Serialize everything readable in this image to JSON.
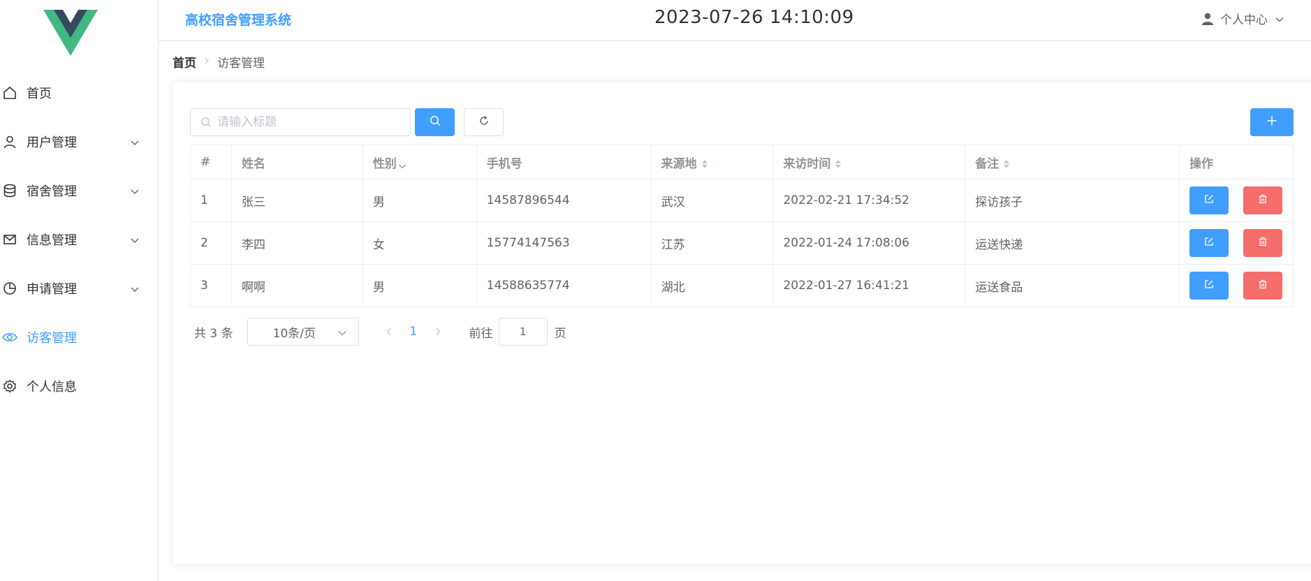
{
  "header": {
    "app_title": "高校宿舍管理系统",
    "datetime": "2023-07-26 14:10:09",
    "user_center_label": "个人中心"
  },
  "sidebar": {
    "items": [
      {
        "label": "首页",
        "icon": "home-icon",
        "has_submenu": false,
        "active": false
      },
      {
        "label": "用户管理",
        "icon": "user-icon",
        "has_submenu": true,
        "active": false
      },
      {
        "label": "宿舍管理",
        "icon": "database-icon",
        "has_submenu": true,
        "active": false
      },
      {
        "label": "信息管理",
        "icon": "mail-icon",
        "has_submenu": true,
        "active": false
      },
      {
        "label": "申请管理",
        "icon": "pie-chart-icon",
        "has_submenu": true,
        "active": false
      },
      {
        "label": "访客管理",
        "icon": "eye-icon",
        "has_submenu": false,
        "active": true
      },
      {
        "label": "个人信息",
        "icon": "gear-icon",
        "has_submenu": false,
        "active": false
      }
    ]
  },
  "breadcrumb": {
    "home": "首页",
    "current": "访客管理"
  },
  "toolbar": {
    "search_placeholder": "请输入标题"
  },
  "table": {
    "columns": [
      "#",
      "姓名",
      "性别",
      "手机号",
      "来源地",
      "来访时间",
      "备注",
      "操作"
    ],
    "rows": [
      {
        "index": "1",
        "name": "张三",
        "gender": "男",
        "phone": "14587896544",
        "origin": "武汉",
        "visit_time": "2022-02-21 17:34:52",
        "note": "探访孩子"
      },
      {
        "index": "2",
        "name": "李四",
        "gender": "女",
        "phone": "15774147563",
        "origin": "江苏",
        "visit_time": "2022-01-24 17:08:06",
        "note": "运送快递"
      },
      {
        "index": "3",
        "name": "啊啊",
        "gender": "男",
        "phone": "14588635774",
        "origin": "湖北",
        "visit_time": "2022-01-27 16:41:21",
        "note": "运送食品"
      }
    ]
  },
  "pagination": {
    "total_text": "共 3 条",
    "page_size": "10条/页",
    "current_page": "1",
    "goto_label": "前往",
    "goto_value": "1",
    "goto_suffix": "页"
  },
  "colors": {
    "primary": "#409eff",
    "danger": "#f56c6c",
    "logo_green": "#41b883",
    "logo_dark": "#35495e"
  }
}
